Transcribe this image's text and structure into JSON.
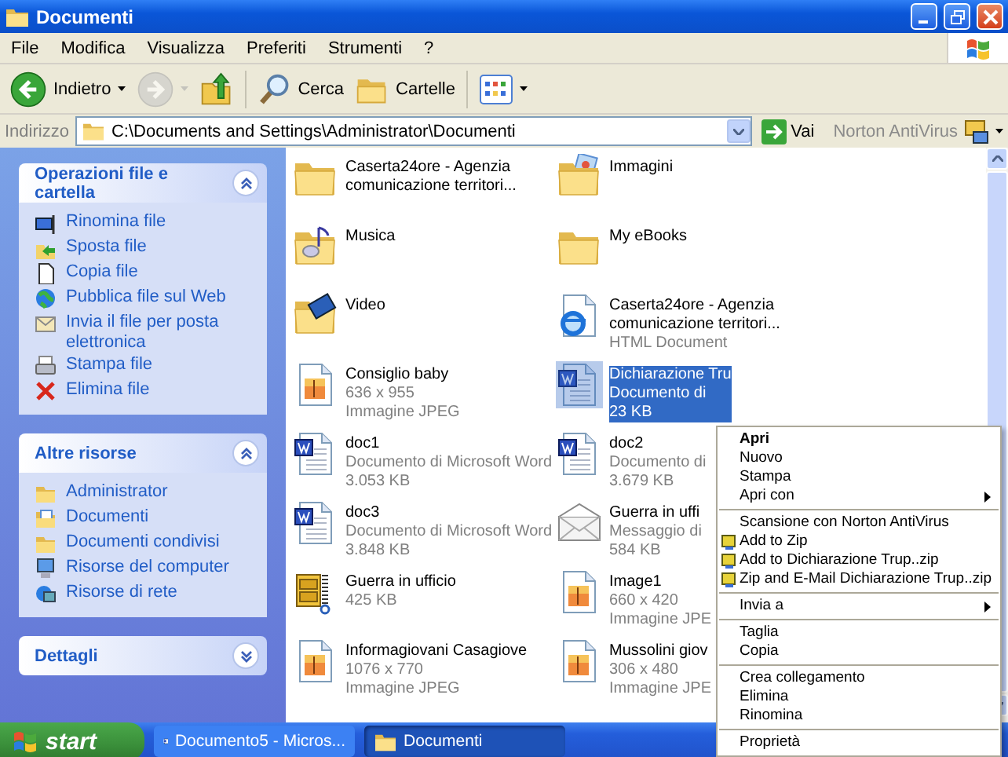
{
  "window": {
    "title": "Documenti"
  },
  "menu_bar": [
    "File",
    "Modifica",
    "Visualizza",
    "Preferiti",
    "Strumenti",
    "?"
  ],
  "toolbar": {
    "buttons": [
      {
        "kind": "back",
        "label": "Indietro",
        "disabled": false
      },
      {
        "kind": "forward",
        "disabled": true
      },
      {
        "kind": "up",
        "disabled": false
      },
      {
        "kind": "search",
        "label": "Cerca",
        "disabled": false
      },
      {
        "kind": "folders",
        "label": "Cartelle",
        "disabled": false
      },
      {
        "kind": "views",
        "disabled": false
      }
    ]
  },
  "address_bar": {
    "label": "Indirizzo",
    "path": "C:\\Documents and Settings\\Administrator\\Documenti",
    "go": "Vai",
    "extra_toolbar": "Norton AntiVirus"
  },
  "sidebar": {
    "panels": [
      {
        "title": "Operazioni file e cartella",
        "expanded": true,
        "items": [
          {
            "label": "Rinomina file",
            "kind": "rename"
          },
          {
            "label": "Sposta file",
            "kind": "move"
          },
          {
            "label": "Copia file",
            "kind": "copy"
          },
          {
            "label": "Pubblica file sul Web",
            "kind": "web"
          },
          {
            "label": "Invia il file per posta elettronica",
            "kind": "mail"
          },
          {
            "label": "Stampa file",
            "kind": "print"
          },
          {
            "label": "Elimina file",
            "kind": "delete"
          }
        ]
      },
      {
        "title": "Altre risorse",
        "expanded": true,
        "items": [
          {
            "label": "Administrator",
            "kind": "folder"
          },
          {
            "label": "Documenti",
            "kind": "docs"
          },
          {
            "label": "Documenti condivisi",
            "kind": "folder"
          },
          {
            "label": "Risorse del computer",
            "kind": "computer"
          },
          {
            "label": "Risorse di rete",
            "kind": "network"
          }
        ]
      },
      {
        "title": "Dettagli",
        "expanded": false
      }
    ]
  },
  "files": [
    {
      "kind": "folder",
      "name": "Caserta24ore - Agenzia comunicazione territori...",
      "selected": false
    },
    {
      "kind": "folder-pictures",
      "name": "Immagini",
      "selected": false
    },
    {
      "kind": "folder-music",
      "name": "Musica",
      "selected": false
    },
    {
      "kind": "folder",
      "name": "My eBooks",
      "selected": false
    },
    {
      "kind": "folder-video",
      "name": "Video",
      "selected": false
    },
    {
      "kind": "html",
      "name": "Caserta24ore - Agenzia comunicazione territori...",
      "details": [
        "HTML Document"
      ],
      "selected": false
    },
    {
      "kind": "jpeg",
      "name": "Consiglio baby",
      "details": [
        "636 x 955",
        "Immagine JPEG"
      ],
      "selected": false
    },
    {
      "kind": "word",
      "name": "Dichiarazione Tru",
      "details": [
        "Documento di",
        "23 KB"
      ],
      "selected": true
    },
    {
      "kind": "word",
      "name": "doc1",
      "details": [
        "Documento di Microsoft Word",
        "3.053 KB"
      ],
      "selected": false
    },
    {
      "kind": "word",
      "name": "doc2",
      "details": [
        "Documento di",
        "3.679 KB"
      ],
      "selected": false
    },
    {
      "kind": "word",
      "name": "doc3",
      "details": [
        "Documento di Microsoft Word",
        "3.848 KB"
      ],
      "selected": false
    },
    {
      "kind": "mail",
      "name": "Guerra in uffi",
      "details": [
        "Messaggio di",
        "584 KB"
      ],
      "selected": false
    },
    {
      "kind": "zip",
      "name": "Guerra in ufficio",
      "details": [
        "425 KB"
      ],
      "selected": false
    },
    {
      "kind": "jpeg",
      "name": "Image1",
      "details": [
        "660 x 420",
        "Immagine JPE"
      ],
      "selected": false
    },
    {
      "kind": "jpeg",
      "name": "Informagiovani Casagiove",
      "details": [
        "1076 x 770",
        "Immagine JPEG"
      ],
      "selected": false
    },
    {
      "kind": "jpeg",
      "name": "Mussolini giov",
      "details": [
        "306 x 480",
        "Immagine JPE"
      ],
      "selected": false
    }
  ],
  "context_menu": {
    "groups": [
      [
        {
          "label": "Apri",
          "kind": "plain",
          "default": true,
          "submenu": false
        },
        {
          "label": "Nuovo",
          "kind": "plain",
          "default": false,
          "submenu": false
        },
        {
          "label": "Stampa",
          "kind": "plain",
          "default": false,
          "submenu": false
        },
        {
          "label": "Apri con",
          "kind": "plain",
          "default": false,
          "submenu": true
        }
      ],
      [
        {
          "label": "Scansione con Norton AntiVirus",
          "kind": "plain",
          "default": false,
          "submenu": false
        },
        {
          "label": "Add to Zip",
          "kind": "zip",
          "default": false,
          "submenu": false
        },
        {
          "label": "Add to Dichiarazione Trup..zip",
          "kind": "zip",
          "default": false,
          "submenu": false
        },
        {
          "label": "Zip and E-Mail Dichiarazione Trup..zip",
          "kind": "zip",
          "default": false,
          "submenu": false
        }
      ],
      [
        {
          "label": "Invia a",
          "kind": "plain",
          "default": false,
          "submenu": true
        }
      ],
      [
        {
          "label": "Taglia",
          "kind": "plain",
          "default": false,
          "submenu": false
        },
        {
          "label": "Copia",
          "kind": "plain",
          "default": false,
          "submenu": false
        }
      ],
      [
        {
          "label": "Crea collegamento",
          "kind": "plain",
          "default": false,
          "submenu": false
        },
        {
          "label": "Elimina",
          "kind": "plain",
          "default": false,
          "submenu": false
        },
        {
          "label": "Rinomina",
          "kind": "plain",
          "default": false,
          "submenu": false
        }
      ],
      [
        {
          "label": "Proprietà",
          "kind": "plain",
          "default": false,
          "submenu": false
        }
      ]
    ]
  },
  "taskbar": {
    "start": "start",
    "tasks": [
      {
        "label": "Documento5 - Micros...",
        "kind": "word",
        "selected": false
      },
      {
        "label": "Documenti",
        "kind": "folder",
        "selected": true
      }
    ]
  }
}
